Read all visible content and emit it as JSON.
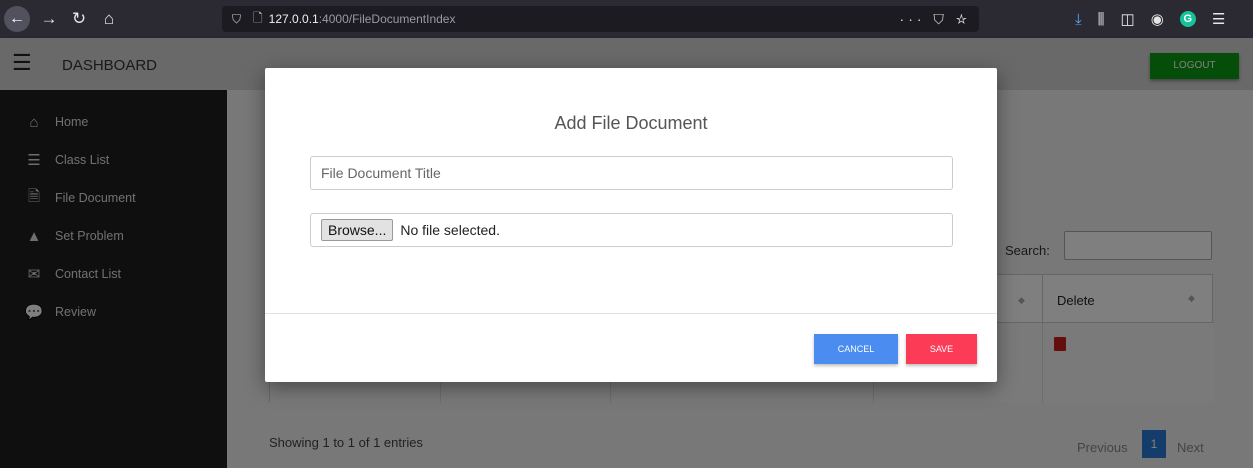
{
  "browser": {
    "url_host": "127.0.0.1",
    "url_path": ":4000/FileDocumentIndex",
    "page_actions": "··· ⛉ ☆"
  },
  "header": {
    "title": "DASHBOARD",
    "logout_label": "LOGOUT"
  },
  "sidebar": {
    "items": [
      {
        "label": "Home",
        "icon": "home-icon",
        "glyph": "⌂"
      },
      {
        "label": "Class List",
        "icon": "list-icon",
        "glyph": "☰"
      },
      {
        "label": "File Document",
        "icon": "file-icon",
        "glyph": "🗎"
      },
      {
        "label": "Set Problem",
        "icon": "warning-icon",
        "glyph": "▲"
      },
      {
        "label": "Contact List",
        "icon": "envelope-icon",
        "glyph": "✉"
      },
      {
        "label": "Review",
        "icon": "comments-icon",
        "glyph": "💬"
      }
    ]
  },
  "table": {
    "search_label": "Search:",
    "delete_header": "Delete",
    "showing": "Showing 1 to 1 of 1 entries",
    "pagination": {
      "previous": "Previous",
      "page": "1",
      "next": "Next"
    }
  },
  "modal": {
    "title": "Add File Document",
    "title_placeholder": "File Document Title",
    "browse_label": "Browse...",
    "file_status": "No file selected.",
    "cancel_label": "CANCEL",
    "save_label": "SAVE"
  },
  "colors": {
    "logout": "#0a9c12",
    "cancel": "#4a8cf0",
    "save": "#fc3b57",
    "pagination_active": "#2a7bd9",
    "delete_icon": "#cc1a1a"
  }
}
